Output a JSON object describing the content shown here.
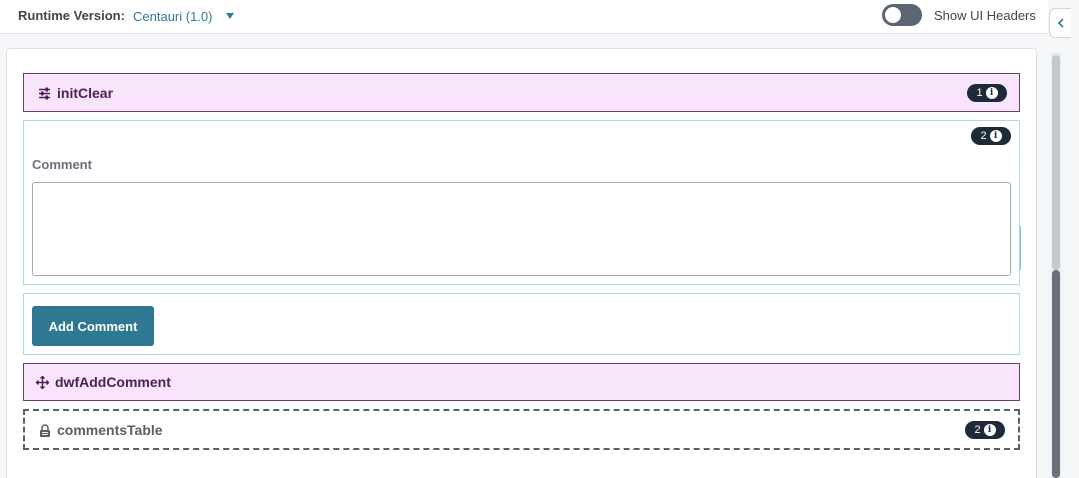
{
  "header": {
    "runtime_label": "Runtime Version:",
    "runtime_value": "Centauri (1.0)",
    "toggle_label": "Show UI Headers",
    "toggle_on": false
  },
  "blocks": {
    "init_clear": {
      "title": "initClear",
      "badge_count": "1",
      "icon": "sliders-icon"
    },
    "comment_group": {
      "badge_count": "2",
      "label": "Comment",
      "value": ""
    },
    "button_group": {
      "button_label": "Add Comment"
    },
    "dwf_add_comment": {
      "title": "dwfAddComment",
      "icon": "move-icon"
    },
    "comments_table": {
      "title": "commentsTable",
      "badge_count": "2",
      "icon": "lock-icon"
    }
  },
  "colors": {
    "accent": "#2e7891",
    "purple_block_bg": "#f9e5fb",
    "purple_block_border": "#6b3d72",
    "badge_bg": "#1f2a38"
  }
}
